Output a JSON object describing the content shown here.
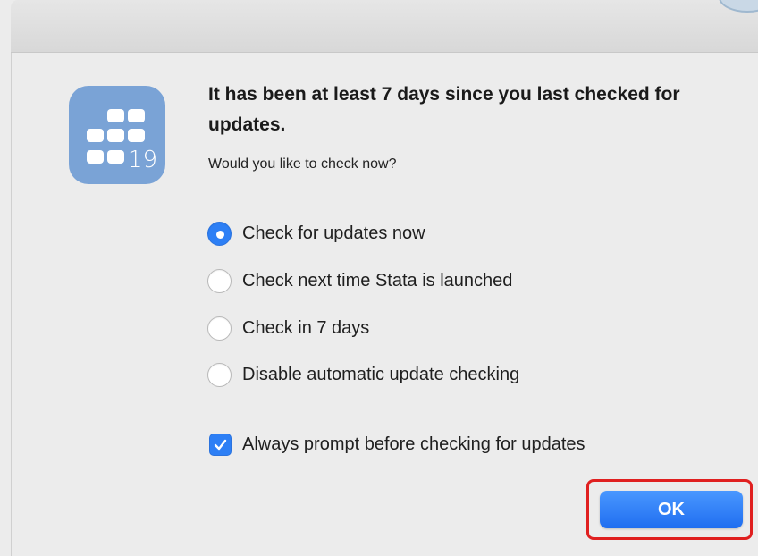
{
  "dialog": {
    "title": "It has been at least 7 days since you last checked for updates.",
    "subtitle": "Would you like to check now?",
    "app_icon": {
      "name": "stata-app-icon",
      "version_text": "19",
      "color": "#7aa3d6"
    },
    "options": [
      {
        "label": "Check for updates now",
        "selected": true
      },
      {
        "label": "Check next time Stata is launched",
        "selected": false
      },
      {
        "label": "Check in 7 days",
        "selected": false
      },
      {
        "label": "Disable automatic update checking",
        "selected": false
      }
    ],
    "checkbox": {
      "label": "Always prompt before checking for updates",
      "checked": true
    },
    "ok_button": {
      "label": "OK",
      "color": "#2d7ff5",
      "highlight_color": "#e02020"
    }
  }
}
